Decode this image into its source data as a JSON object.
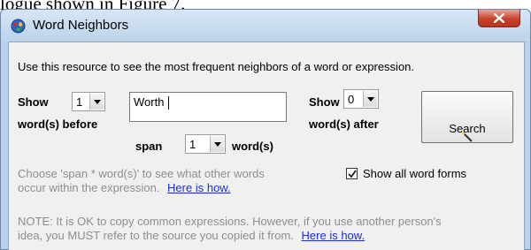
{
  "document": {
    "text": "logue shown in Figure 7."
  },
  "window": {
    "title": "Word Neighbors",
    "icons": {
      "app": "globe-icon",
      "close": "close-icon"
    }
  },
  "dialog": {
    "intro": "Use this resource to see the most frequent neighbors of a word or expression.",
    "before": {
      "show_label": "Show",
      "value": "1",
      "unit_label": "word(s) before"
    },
    "word_input": {
      "value": "Worth"
    },
    "after": {
      "show_label": "Show",
      "value": "0",
      "unit_label": "word(s) after"
    },
    "search_button": {
      "label": "Search",
      "icon": "magic-wand-icon"
    },
    "span": {
      "label": "span",
      "value": "1",
      "unit_label": "word(s)"
    },
    "span_help": {
      "line1": "Choose 'span * word(s)' to see what other words",
      "line2": "occur within the expression.",
      "link": "Here is how."
    },
    "show_all_forms": {
      "label": "Show all word forms",
      "checked": true
    },
    "note": {
      "line1": "NOTE: It is OK to copy common expressions. However, if you use another person's",
      "line2": "idea, you MUST refer to the source you copied it from.",
      "link": "Here is how."
    }
  }
}
